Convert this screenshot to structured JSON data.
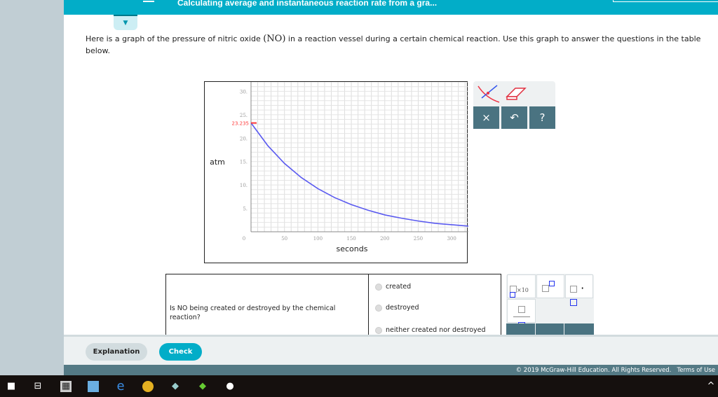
{
  "header": {
    "title": "Calculating average and instantaneous reaction rate from a gra..."
  },
  "prompt": {
    "before": "Here is a graph of the pressure of nitric oxide ",
    "species": "(NO)",
    "after": " in a reaction vessel during a certain chemical reaction. Use this graph to answer the questions in the table below."
  },
  "chart_data": {
    "type": "line",
    "xlabel": "seconds",
    "ylabel": "atm",
    "xlim": [
      0,
      325
    ],
    "ylim": [
      0,
      32
    ],
    "xticks": [
      0,
      50,
      100,
      150,
      200,
      250,
      300
    ],
    "yticks": [
      5,
      10,
      15,
      20,
      25,
      30
    ],
    "grid": true,
    "series": [
      {
        "color": "#5a5af0",
        "x": [
          0,
          25,
          50,
          75,
          100,
          125,
          150,
          175,
          200,
          225,
          250,
          275,
          300,
          325
        ],
        "y": [
          23.235,
          18.4,
          14.6,
          11.6,
          9.2,
          7.3,
          5.8,
          4.6,
          3.6,
          2.9,
          2.3,
          1.8,
          1.5,
          1.2
        ]
      }
    ],
    "annotations": [
      {
        "text": "23.235",
        "y": 23.235,
        "color": "#ff3b3b"
      }
    ]
  },
  "tools": {
    "clear": "×",
    "undo": "↶",
    "help": "?"
  },
  "question": {
    "text": "Is NO being created or destroyed by the chemical reaction?",
    "options": [
      "created",
      "destroyed",
      "neither created nor destroyed"
    ]
  },
  "mathpad": {
    "x10": "×10"
  },
  "bottom": {
    "explanation": "Explanation",
    "check": "Check"
  },
  "footer": {
    "copyright": "© 2019 McGraw-Hill Education. All Rights Reserved.",
    "terms": "Terms of Use"
  }
}
